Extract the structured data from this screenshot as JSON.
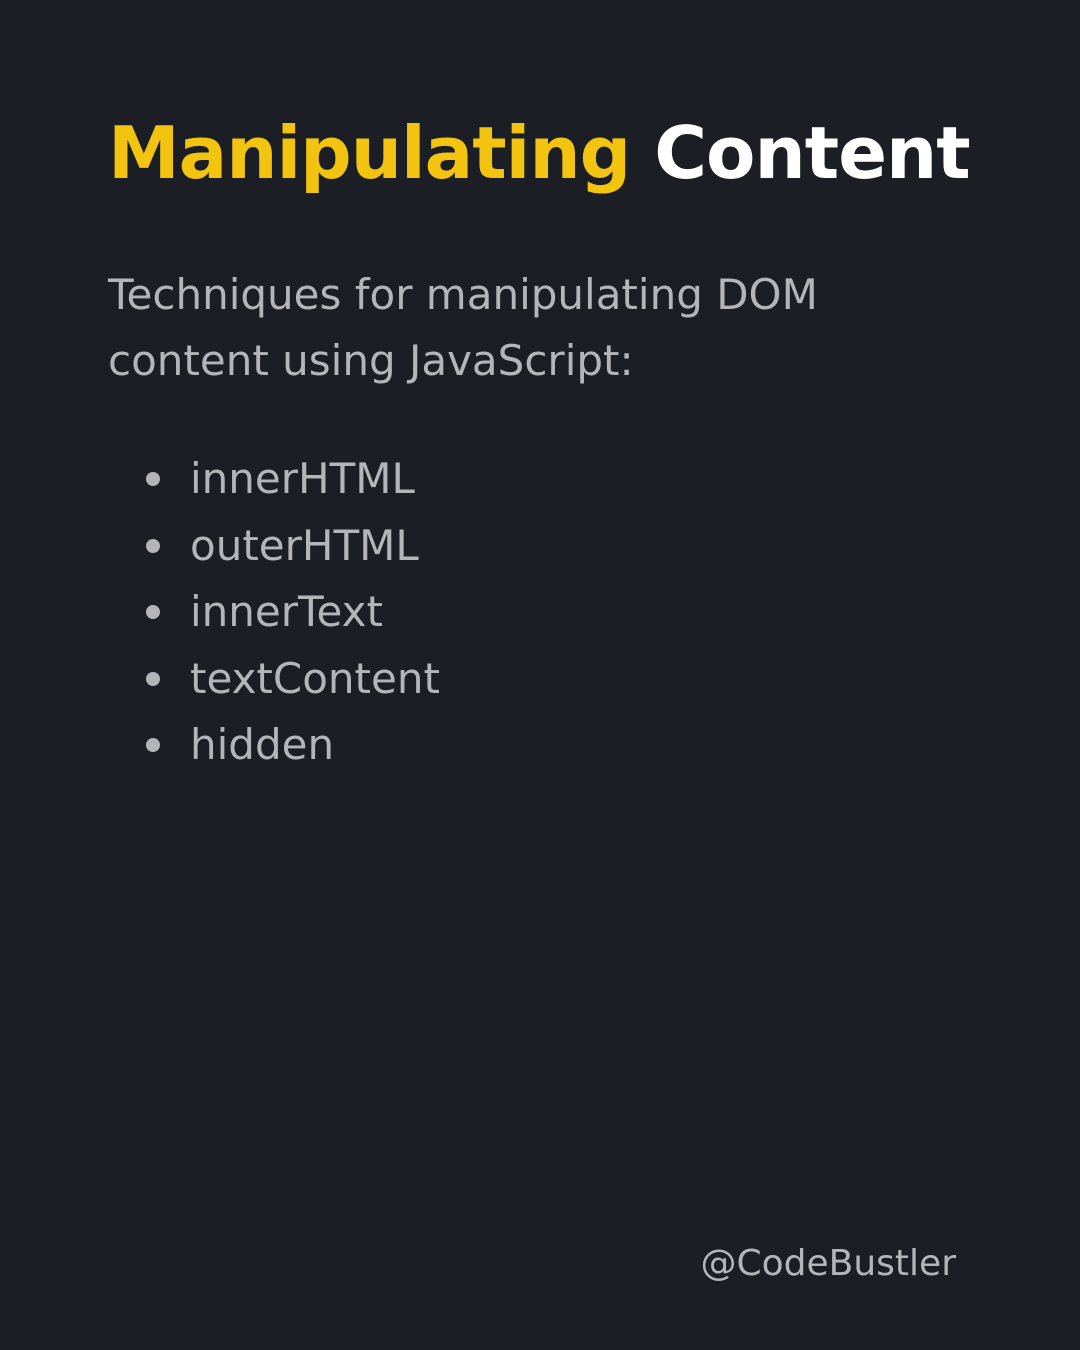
{
  "slide": {
    "title": {
      "highlight": "Manipulating",
      "rest": "Content"
    },
    "intro": "Techniques for manipulating DOM content using JavaScript:",
    "items": [
      {
        "label": "innerHTML"
      },
      {
        "label": "outerHTML"
      },
      {
        "label": "innerText"
      },
      {
        "label": "textContent"
      },
      {
        "label": "hidden"
      }
    ],
    "handle": "@CodeBustler"
  },
  "colors": {
    "background": "#1b1e25",
    "accent": "#f2c40f",
    "title_text": "#ffffff",
    "body_text": "#b3b5b9"
  }
}
